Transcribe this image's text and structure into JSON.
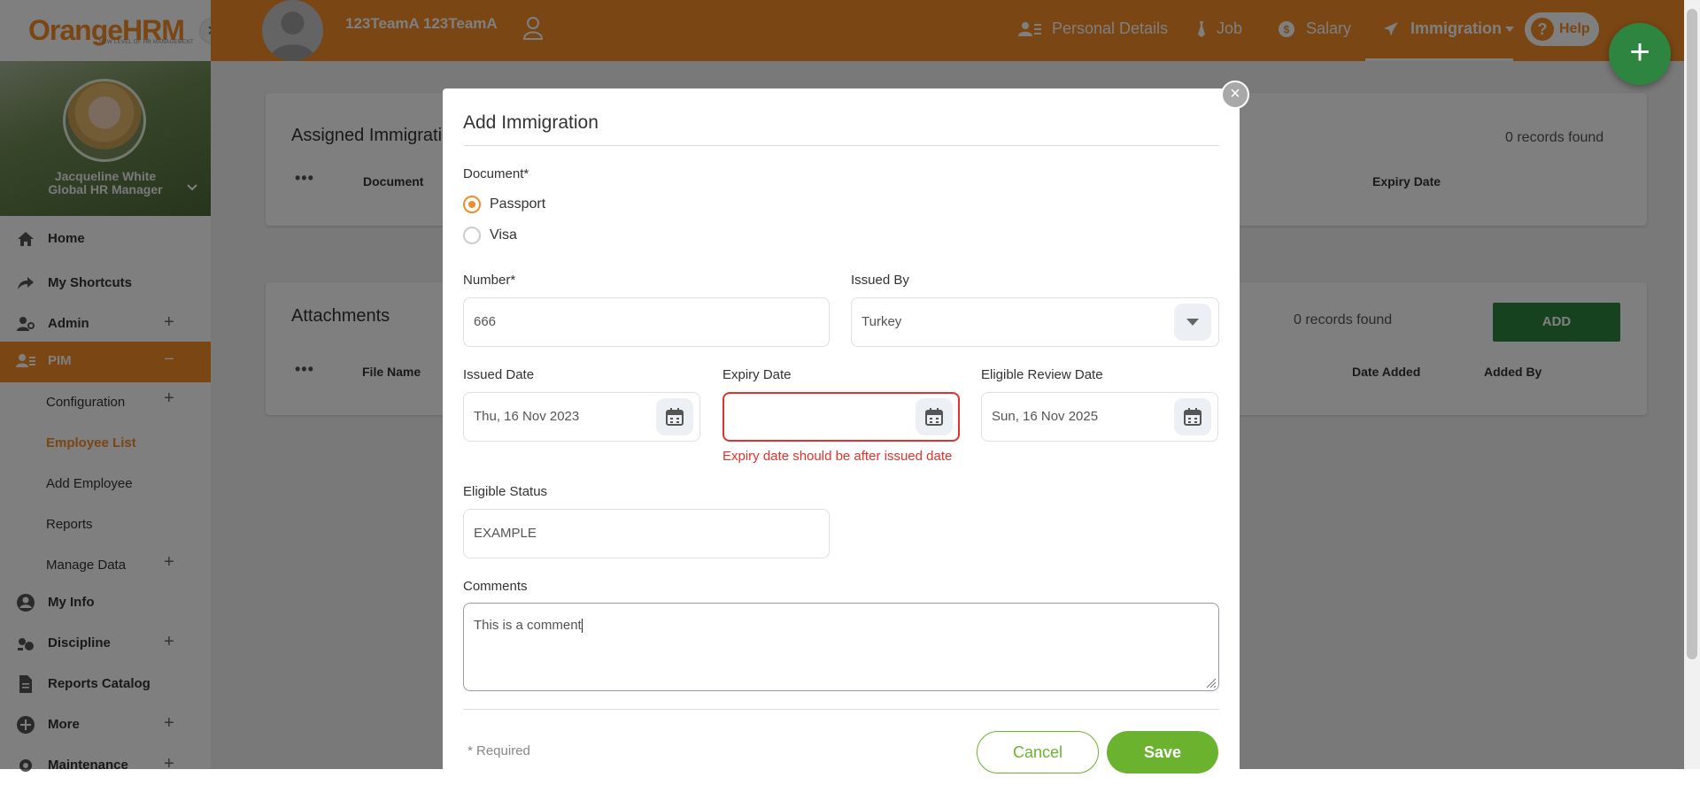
{
  "sidebar": {
    "logo_text": "OrangeHRM",
    "logo_tagline": "NEW LEVEL OF HR MANAGEMENT",
    "close_glyph": "×",
    "user_name": "Jacqueline White",
    "user_role": "Global HR Manager",
    "menu": [
      {
        "label": "Home",
        "icon": "home-icon",
        "expandable": false
      },
      {
        "label": "My Shortcuts",
        "icon": "share-icon",
        "expandable": false
      },
      {
        "label": "Admin",
        "icon": "admin-icon",
        "expandable": true
      },
      {
        "label": "PIM",
        "icon": "pim-icon",
        "expandable": true,
        "active": true
      },
      {
        "label": "My Info",
        "icon": "user-circle-icon",
        "expandable": false
      },
      {
        "label": "Discipline",
        "icon": "discipline-icon",
        "expandable": true
      },
      {
        "label": "Reports Catalog",
        "icon": "file-icon",
        "expandable": false
      },
      {
        "label": "More",
        "icon": "plus-circle-icon",
        "expandable": true
      },
      {
        "label": "Maintenance",
        "icon": "gear-icon",
        "expandable": true
      }
    ],
    "pim_submenu": [
      {
        "label": "Configuration",
        "expandable": true
      },
      {
        "label": "Employee List",
        "current": true
      },
      {
        "label": "Add Employee"
      },
      {
        "label": "Reports"
      },
      {
        "label": "Manage Data",
        "expandable": true
      }
    ]
  },
  "header": {
    "employee_name": "123TeamA 123TeamA",
    "tabs": [
      {
        "label": "Personal Details",
        "icon": "personal-details-icon"
      },
      {
        "label": "Job",
        "icon": "job-icon"
      },
      {
        "label": "Salary",
        "icon": "salary-icon"
      },
      {
        "label": "Immigration",
        "icon": "plane-icon",
        "active": true
      }
    ],
    "help_label": "Help",
    "fab_glyph": "+"
  },
  "background": {
    "immigration_card": {
      "title": "Assigned Immigration Records",
      "records": "0 records found",
      "columns": [
        "Document",
        "Expiry Date"
      ]
    },
    "attachments_card": {
      "title": "Attachments",
      "records": "0 records found",
      "add_label": "ADD",
      "columns": [
        "File Name",
        "Date Added",
        "Added By"
      ]
    }
  },
  "modal": {
    "title": "Add Immigration",
    "close_glyph": "×",
    "document_label": "Document*",
    "document_options": [
      {
        "label": "Passport",
        "selected": true
      },
      {
        "label": "Visa",
        "selected": false
      }
    ],
    "number_label": "Number*",
    "number_value": "666",
    "issued_by_label": "Issued By",
    "issued_by_value": "Turkey",
    "issued_date_label": "Issued Date",
    "issued_date_value": "Thu, 16 Nov 2023",
    "expiry_date_label": "Expiry Date",
    "expiry_date_value": "",
    "expiry_error": "Expiry date should be after issued date",
    "eligible_review_label": "Eligible Review Date",
    "eligible_review_value": "Sun, 16 Nov 2025",
    "eligible_status_label": "Eligible Status",
    "eligible_status_value": "EXAMPLE",
    "comments_label": "Comments",
    "comments_value": "This is a comment",
    "required_note": "* Required",
    "cancel_label": "Cancel",
    "save_label": "Save"
  },
  "colors": {
    "brand_orange": "#f28c28",
    "fab_green": "#2e8540",
    "save_green": "#6bb32e",
    "error_red": "#e4312b"
  }
}
